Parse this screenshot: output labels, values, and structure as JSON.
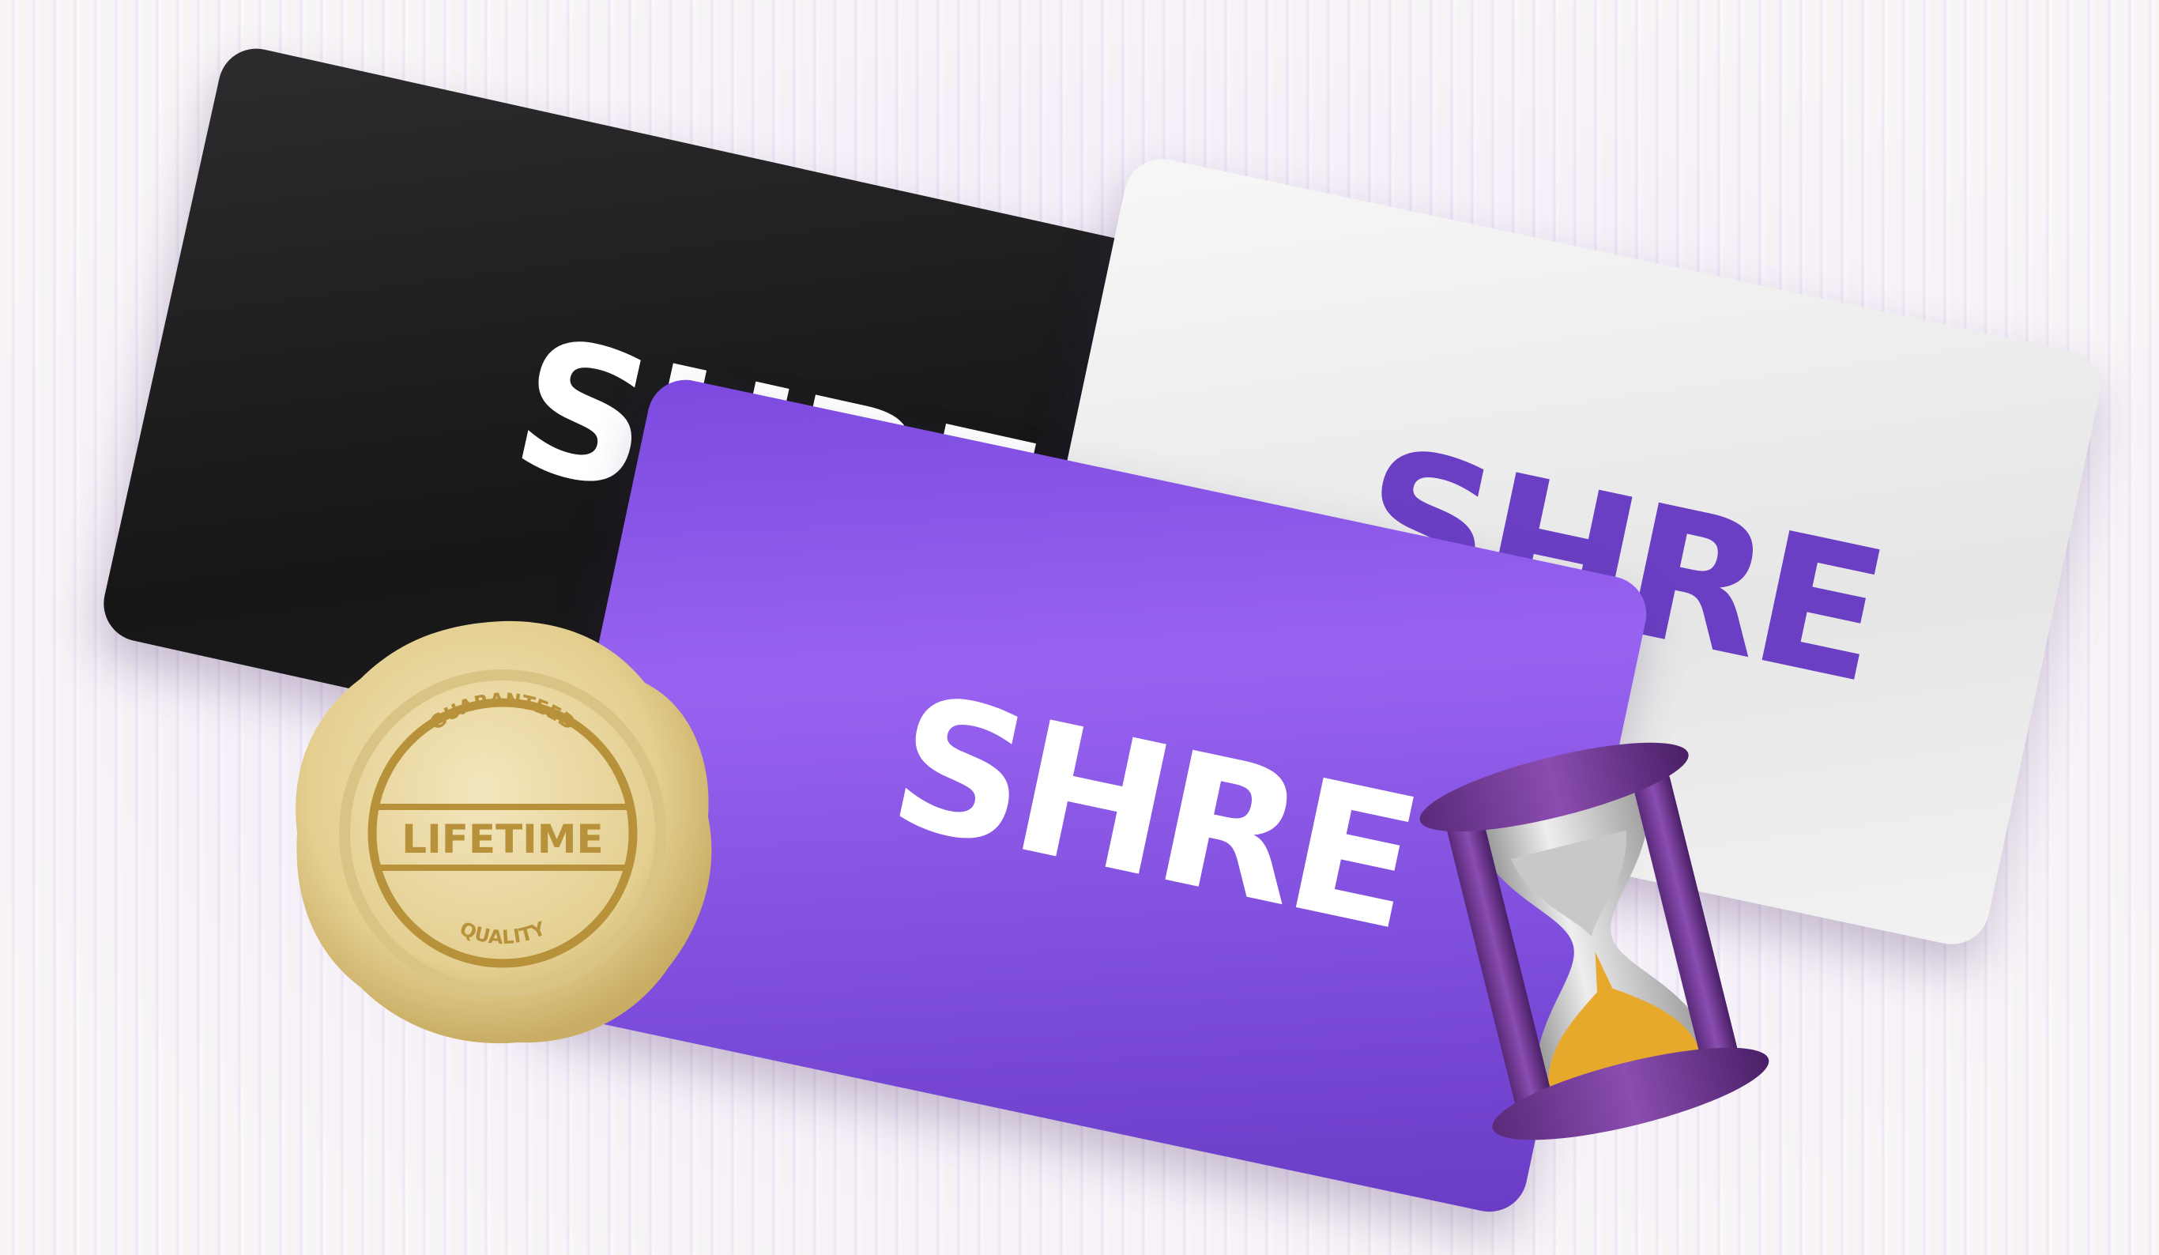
{
  "cards": [
    {
      "color": "black",
      "logo": "SHRE"
    },
    {
      "color": "white",
      "logo": "SHRE"
    },
    {
      "color": "purple",
      "logo": "SHRE"
    }
  ],
  "seal": {
    "top": "GUARANTEED",
    "middle": "LIFETIME",
    "bottom": "QUALITY",
    "color": "#e6d59e"
  },
  "colors": {
    "purple": "#8b5cf0",
    "black": "#1c1c1d",
    "white": "#efefef",
    "accent_text": "#b8923a"
  }
}
